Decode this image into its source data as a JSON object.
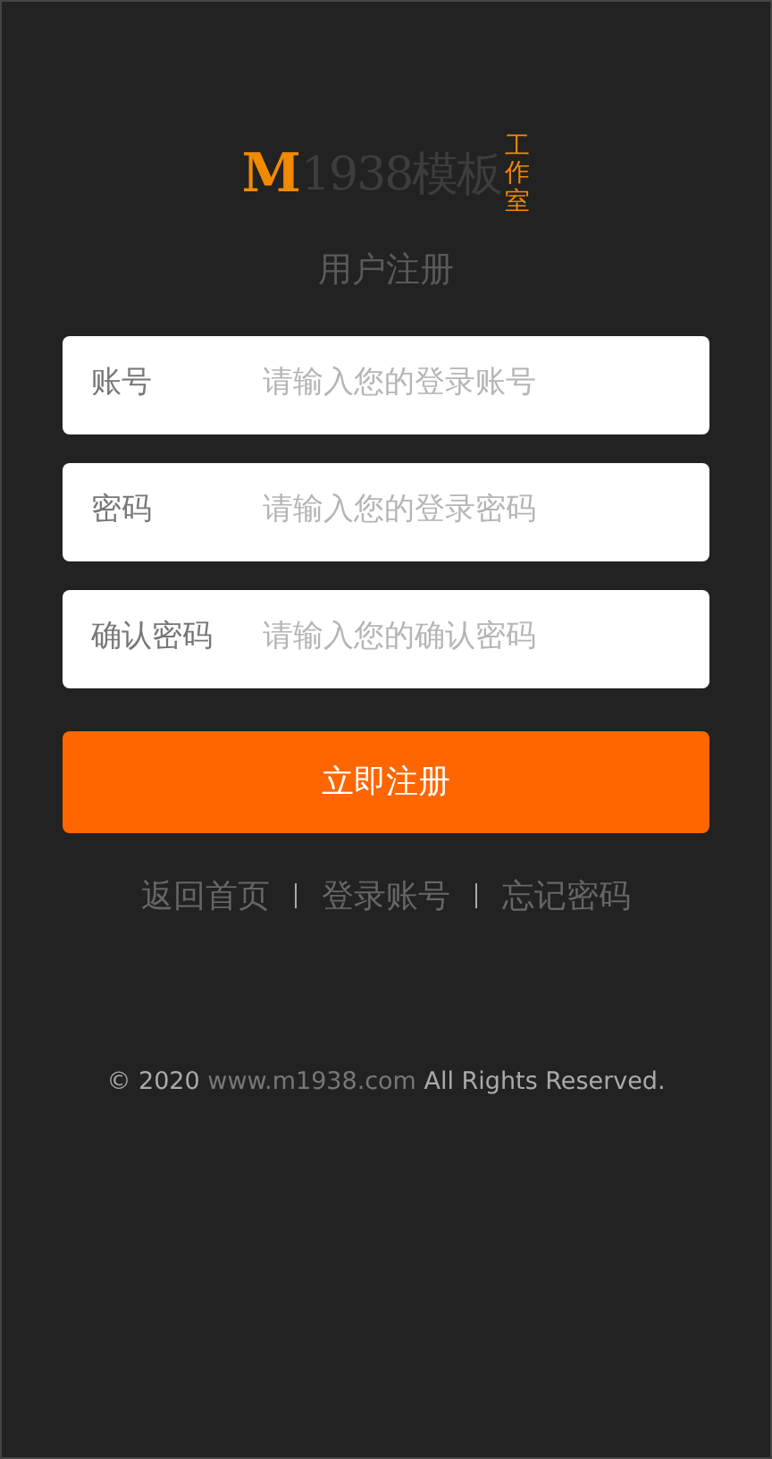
{
  "logo": {
    "initial": "M",
    "name": "1938模板",
    "tag": "工作室"
  },
  "title": "用户注册",
  "fields": [
    {
      "label": "账号",
      "placeholder": "请输入您的登录账号"
    },
    {
      "label": "密码",
      "placeholder": "请输入您的登录密码"
    },
    {
      "label": "确认密码",
      "placeholder": "请输入您的确认密码"
    }
  ],
  "submit": "立即注册",
  "links": [
    "返回首页",
    "登录账号",
    "忘记密码"
  ],
  "footer": {
    "before": "© 2020 ",
    "link": "www.m1938.com",
    "after": " All Rights Reserved."
  }
}
